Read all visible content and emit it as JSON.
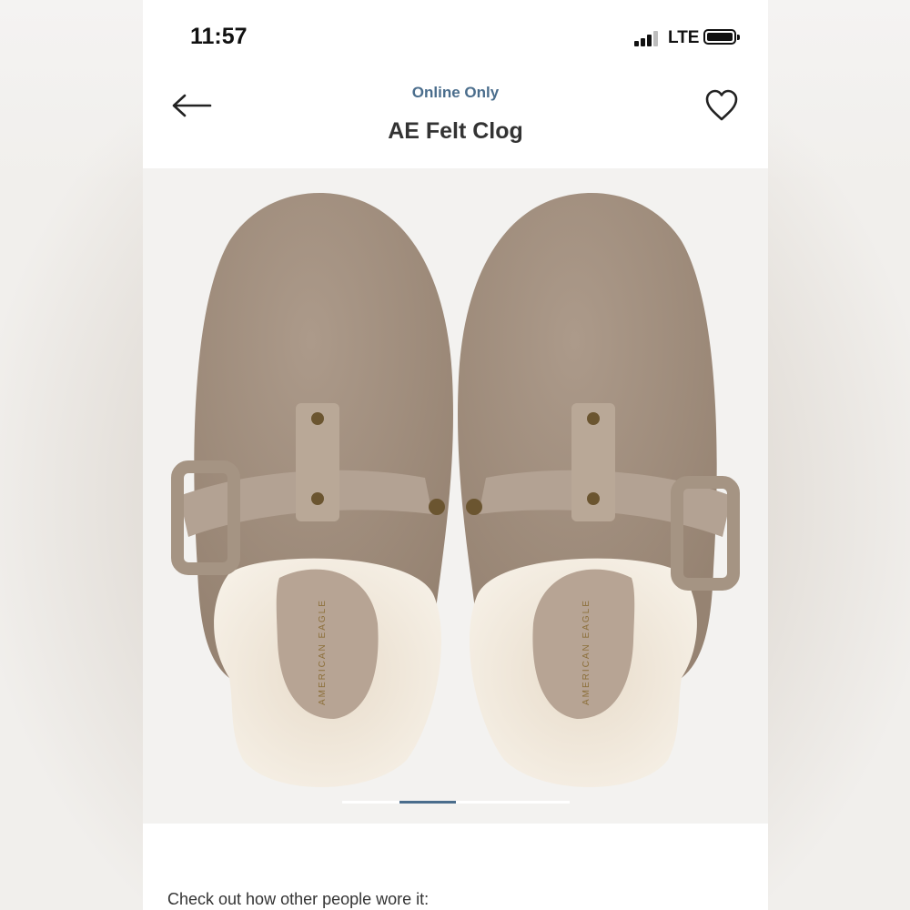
{
  "status_bar": {
    "time": "11:57",
    "network": "LTE",
    "signal_icon": "cell-signal-icon",
    "battery_icon": "battery-icon"
  },
  "header": {
    "back_icon": "arrow-left-icon",
    "tag": "Online Only",
    "title": "AE Felt Clog",
    "wishlist_icon": "heart-outline-icon"
  },
  "gallery": {
    "insole_brand": "AMERICAN EAGLE",
    "page_count": 4,
    "active_page": 2,
    "colors": {
      "felt": "#a69383",
      "suede": "#b3a293",
      "sherpa": "#efe6d8",
      "insole": "#b7a494",
      "active_indicator": "#4a6d8c"
    }
  },
  "footer": {
    "caption": "Check out how other people wore it:"
  }
}
